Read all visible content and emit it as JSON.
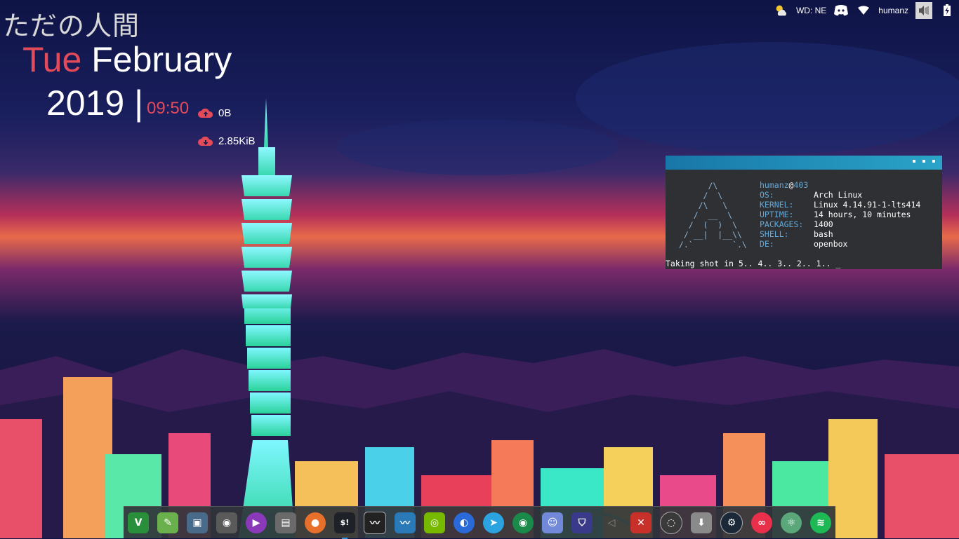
{
  "desktop": {
    "title_jp": "ただの人間",
    "date": {
      "day_of_week": "Tue",
      "month": "February",
      "year": "2019 |",
      "time": "09:50"
    },
    "network": {
      "upload": "0B",
      "download": "2.85KiB"
    }
  },
  "tray": {
    "weather_label": "WD: NE",
    "username": "humanz"
  },
  "terminal": {
    "host": "humanz",
    "host_at": "@",
    "host_suffix": "403",
    "art": "       /\\\n      /  \\\n     /\\   \\\n    /  __  \\\n   /  (  )  \\\n  / __|  |__\\\\\n /.`        `.\\",
    "info": [
      {
        "key": "OS:",
        "value": "Arch Linux"
      },
      {
        "key": "KERNEL:",
        "value": "Linux 4.14.91-1-lts414"
      },
      {
        "key": "UPTIME:",
        "value": "14 hours, 10 minutes"
      },
      {
        "key": "PACKAGES:",
        "value": "1400"
      },
      {
        "key": "SHELL:",
        "value": "bash"
      },
      {
        "key": "DE:",
        "value": "openbox"
      }
    ],
    "prompt": "Taking shot in 5.. 4.. 3.. 2.. 1.. _"
  },
  "dock": {
    "terminal_glyph": "$!",
    "apps": [
      {
        "name": "vim",
        "color": "#2a8f3a"
      },
      {
        "name": "leafpad",
        "color": "#6ab04c"
      },
      {
        "name": "screenshot",
        "color": "#4a6a8a"
      },
      {
        "name": "gimp",
        "color": "#5a5a5a"
      },
      {
        "name": "media-player",
        "color": "#8a3ab8"
      },
      {
        "name": "file-manager",
        "color": "#6a6a6a"
      },
      {
        "name": "firefox",
        "color": "#e8702a"
      },
      {
        "name": "terminal",
        "color": "#1e2228"
      },
      {
        "name": "system-monitor",
        "color": "#222222"
      },
      {
        "name": "activity-monitor",
        "color": "#2a7ab8"
      },
      {
        "name": "nvidia",
        "color": "#76b900"
      },
      {
        "name": "browser-globe",
        "color": "#2a6ad8"
      },
      {
        "name": "telegram",
        "color": "#2aa3e0"
      },
      {
        "name": "camera",
        "color": "#1a8a4a"
      },
      {
        "name": "discord",
        "color": "#7289da"
      },
      {
        "name": "vpn-shield",
        "color": "#3a3a8a"
      },
      {
        "name": "sound",
        "color": "#3a3a3a"
      },
      {
        "name": "dota",
        "color": "#c8302a"
      },
      {
        "name": "obs",
        "color": "#3a3a3a"
      },
      {
        "name": "installer",
        "color": "#8a8a8a"
      },
      {
        "name": "steam",
        "color": "#1b2838"
      },
      {
        "name": "flickr",
        "color": "#e8304a"
      },
      {
        "name": "atom",
        "color": "#5aa87a"
      },
      {
        "name": "spotify",
        "color": "#1db954"
      }
    ]
  }
}
